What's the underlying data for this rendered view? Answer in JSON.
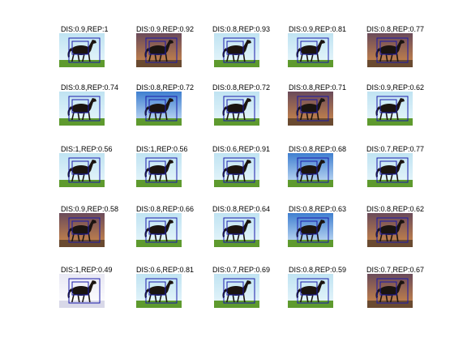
{
  "figure": {
    "panels": [
      {
        "label": "DIS:0.9,REP:1",
        "scene": "sky"
      },
      {
        "label": "DIS:0.9,REP:0.92",
        "scene": "sunset"
      },
      {
        "label": "DIS:0.8,REP:0.93",
        "scene": "sky"
      },
      {
        "label": "DIS:0.9,REP:0.81",
        "scene": "sky"
      },
      {
        "label": "DIS:0.8,REP:0.77",
        "scene": "sunset"
      },
      {
        "label": "DIS:0.8,REP:0.74",
        "scene": "sky"
      },
      {
        "label": "DIS:0.8,REP:0.72",
        "scene": "blue"
      },
      {
        "label": "DIS:0.8,REP:0.72",
        "scene": "sky"
      },
      {
        "label": "DIS:0.8,REP:0.71",
        "scene": "sunset"
      },
      {
        "label": "DIS:0.9,REP:0.62",
        "scene": "sky"
      },
      {
        "label": "DIS:1,REP:0.56",
        "scene": "sky"
      },
      {
        "label": "DIS:1,REP:0.56",
        "scene": "sky"
      },
      {
        "label": "DIS:0.6,REP:0.91",
        "scene": "sky"
      },
      {
        "label": "DIS:0.8,REP:0.68",
        "scene": "blue"
      },
      {
        "label": "DIS:0.7,REP:0.77",
        "scene": "sky"
      },
      {
        "label": "DIS:0.9,REP:0.58",
        "scene": "sunset"
      },
      {
        "label": "DIS:0.8,REP:0.66",
        "scene": "sky"
      },
      {
        "label": "DIS:0.8,REP:0.64",
        "scene": "sky"
      },
      {
        "label": "DIS:0.8,REP:0.63",
        "scene": "blue"
      },
      {
        "label": "DIS:0.8,REP:0.62",
        "scene": "sunset"
      },
      {
        "label": "DIS:1,REP:0.49",
        "scene": "snow"
      },
      {
        "label": "DIS:0.6,REP:0.81",
        "scene": "sky"
      },
      {
        "label": "DIS:0.7,REP:0.69",
        "scene": "sky"
      },
      {
        "label": "DIS:0.8,REP:0.59",
        "scene": "sky"
      },
      {
        "label": "DIS:0.7,REP:0.67",
        "scene": "sunset"
      }
    ],
    "colors": {
      "box": "#1a1aaa",
      "horse": "#1b1410",
      "grass": "#5e9a2e",
      "sky_top": "#bfe3f2",
      "sky_bottom": "#eaf7fb",
      "sunset_top": "#6a4a5a",
      "sunset_bottom": "#d08a4a",
      "blue_top": "#3f7fd0",
      "blue_bottom": "#cfe4f7",
      "snow": "#e8e8f4"
    }
  }
}
